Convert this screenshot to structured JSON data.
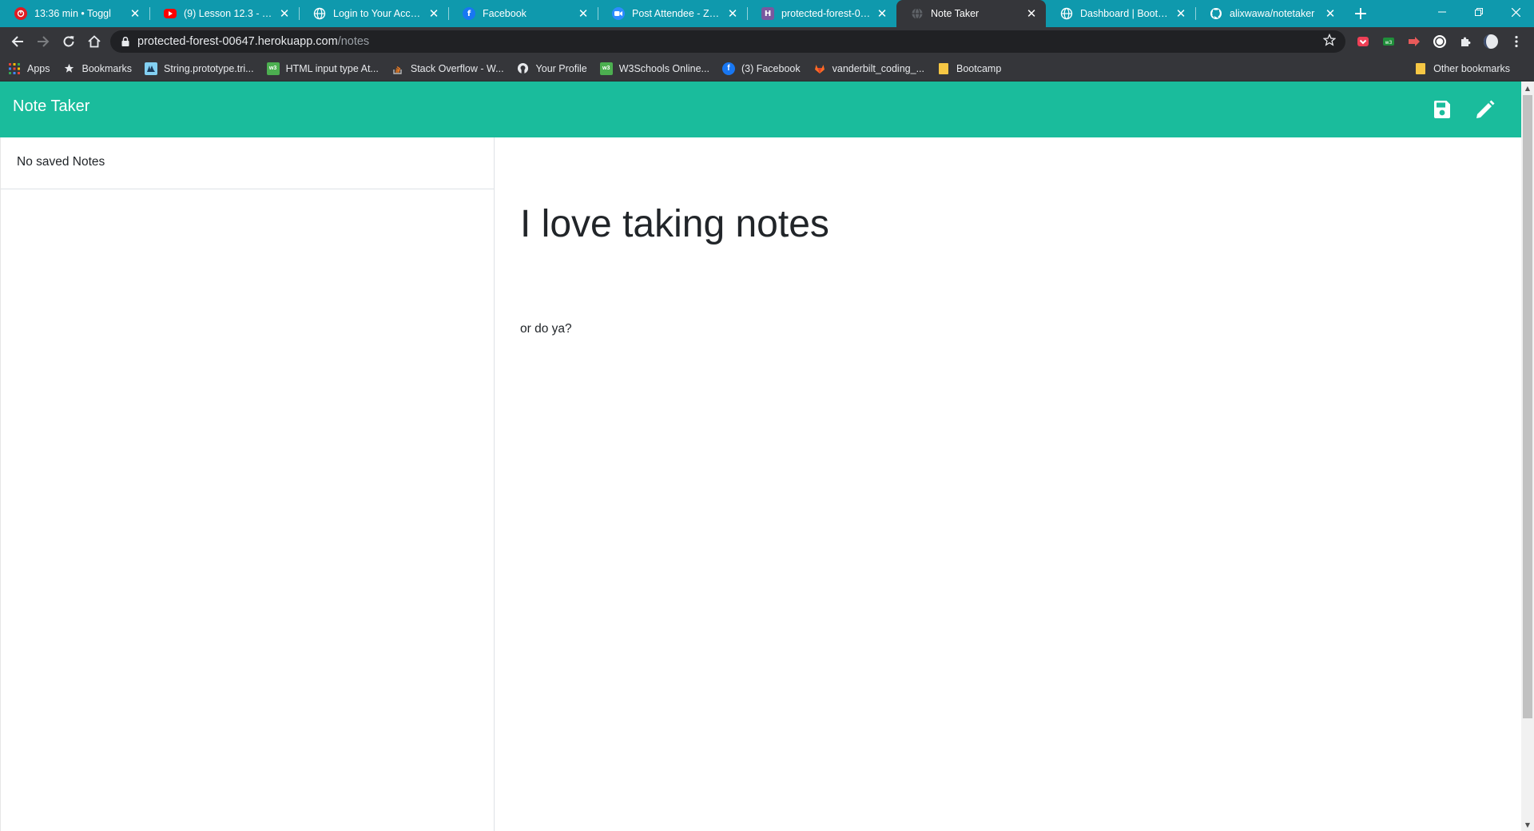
{
  "browser": {
    "tabs": [
      {
        "title": "13:36 min • Toggl",
        "icon": "toggl-icon",
        "color": "#e01b22"
      },
      {
        "title": "(9) Lesson 12.3 - Two D",
        "icon": "youtube-icon",
        "color": "#ff0000"
      },
      {
        "title": "Login to Your Account",
        "icon": "globe-icon",
        "color": "#ffffff"
      },
      {
        "title": "Facebook",
        "icon": "facebook-icon",
        "color": "#1877f2"
      },
      {
        "title": "Post Attendee - Zoom",
        "icon": "zoom-icon",
        "color": "#2d8cff"
      },
      {
        "title": "protected-forest-0064",
        "icon": "heroku-icon",
        "color": "#79589f"
      },
      {
        "title": "Note Taker",
        "icon": "globe-icon",
        "color": "#9aa0a6",
        "active": true
      },
      {
        "title": "Dashboard | Bootcamp",
        "icon": "globe-icon",
        "color": "#ffffff"
      },
      {
        "title": "alixwawa/notetaker",
        "icon": "github-icon",
        "color": "#ffffff"
      }
    ],
    "url_host": "protected-forest-00647.herokuapp.com",
    "url_path": "/notes",
    "bookmarks": [
      {
        "label": "Apps",
        "icon": "apps-grid-icon",
        "color": "#ea4335"
      },
      {
        "label": "Bookmarks",
        "icon": "star-icon",
        "color": "#e8eaed"
      },
      {
        "label": "String.prototype.tri...",
        "icon": "mdn-icon",
        "color": "#83d0f2"
      },
      {
        "label": "HTML input type At...",
        "icon": "w3schools-icon",
        "color": "#4caf50"
      },
      {
        "label": "Stack Overflow - W...",
        "icon": "stackoverflow-icon",
        "color": "#f48024"
      },
      {
        "label": "Your Profile",
        "icon": "github-icon",
        "color": "#ffffff"
      },
      {
        "label": "W3Schools Online...",
        "icon": "w3schools-icon",
        "color": "#4caf50"
      },
      {
        "label": "(3) Facebook",
        "icon": "facebook-icon",
        "color": "#1877f2"
      },
      {
        "label": "vanderbilt_coding_...",
        "icon": "gitlab-icon",
        "color": "#fc6d26"
      },
      {
        "label": "Bootcamp",
        "icon": "folder-icon",
        "color": "#f6c744"
      }
    ],
    "other_bookmarks": "Other bookmarks"
  },
  "app": {
    "brand": "Note Taker",
    "accent_color": "#1abc9c",
    "save_icon": "save-icon",
    "new_note_icon": "pencil-icon",
    "sidebar": {
      "empty_text": "No saved Notes"
    },
    "note": {
      "title": "I love taking notes",
      "body": "or do ya?"
    }
  }
}
